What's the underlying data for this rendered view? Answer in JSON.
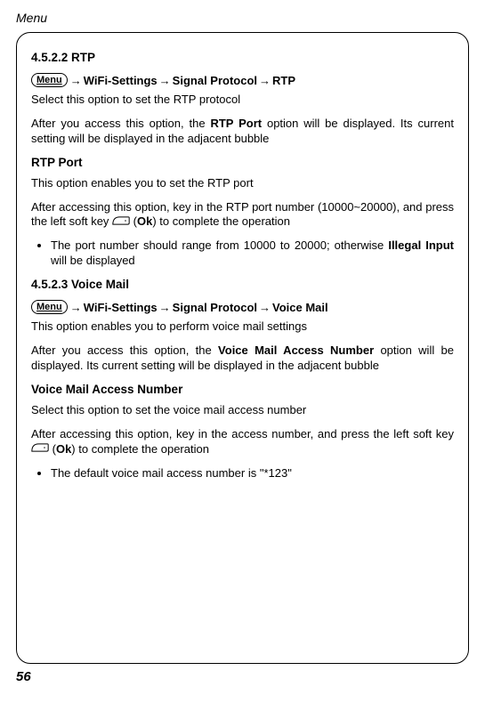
{
  "header": "Menu",
  "page_number": "56",
  "s1": {
    "heading": "4.5.2.2 RTP",
    "menu_label": "Menu",
    "bc1": "WiFi-Settings",
    "bc2": "Signal Protocol",
    "bc3": "RTP",
    "p1": "Select this option to set the RTP protocol",
    "p2a": "After you access this option, the ",
    "p2b": "RTP Port",
    "p2c": " option will be displayed. Its current setting will be displayed in the adjacent bubble",
    "sub1": "RTP Port",
    "p3": "This option enables you to set the RTP port",
    "p4a": "After accessing this option, key in the RTP port number (10000~20000), and press the left soft key ",
    "p4b": " (",
    "p4c": "Ok",
    "p4d": ") to complete the operation",
    "li1a": "The port number should range from 10000 to 20000; otherwise ",
    "li1b": "Illegal Input",
    "li1c": " will be displayed"
  },
  "s2": {
    "heading": "4.5.2.3 Voice Mail",
    "menu_label": "Menu",
    "bc1": "WiFi-Settings",
    "bc2": "Signal Protocol",
    "bc3": "Voice Mail",
    "p1": "This option enables you to perform voice mail settings",
    "p2a": "After you access this option, the ",
    "p2b": "Voice Mail Access Number",
    "p2c": " option will be displayed. Its current setting will be displayed in the adjacent bubble",
    "sub1": "Voice Mail Access Number",
    "p3": "Select this option to set the voice mail access number",
    "p4a": "After accessing this option, key in the access number, and press the left soft key ",
    "p4b": " (",
    "p4c": "Ok",
    "p4d": ") to complete the operation",
    "li1": "The default voice mail access number is \"*123\""
  }
}
